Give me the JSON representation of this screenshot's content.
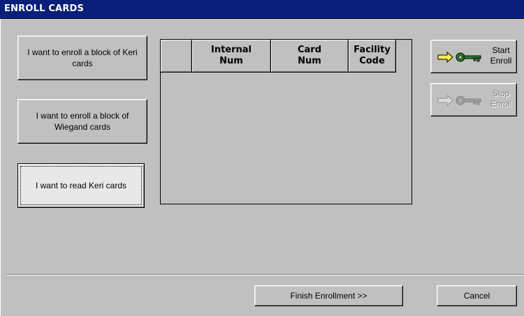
{
  "window": {
    "title": "ENROLL CARDS"
  },
  "options": {
    "enroll_keri": "I want to enroll a block of Keri cards",
    "enroll_wiegand": "I want to enroll a block of Wiegand cards",
    "read_keri": "I want to read Keri cards"
  },
  "grid": {
    "columns": [
      "",
      "Internal Num",
      "Card Num",
      "Facility Code"
    ],
    "rows": []
  },
  "actions": {
    "start_enroll": "Start Enroll",
    "stop_enroll": "Stop Enroll"
  },
  "footer": {
    "finish_label": "Finish Enrollment >>",
    "cancel_label": "Cancel"
  },
  "icons": {
    "start": "yellow-arrow-green-key-icon",
    "stop": "gray-arrow-gray-key-icon"
  },
  "colors": {
    "title_bar": "#0a1f7a",
    "face": "#c0c0c0",
    "start_arrow": "#f5f04a",
    "start_key": "#2e7d2e",
    "disabled": "#808080"
  }
}
